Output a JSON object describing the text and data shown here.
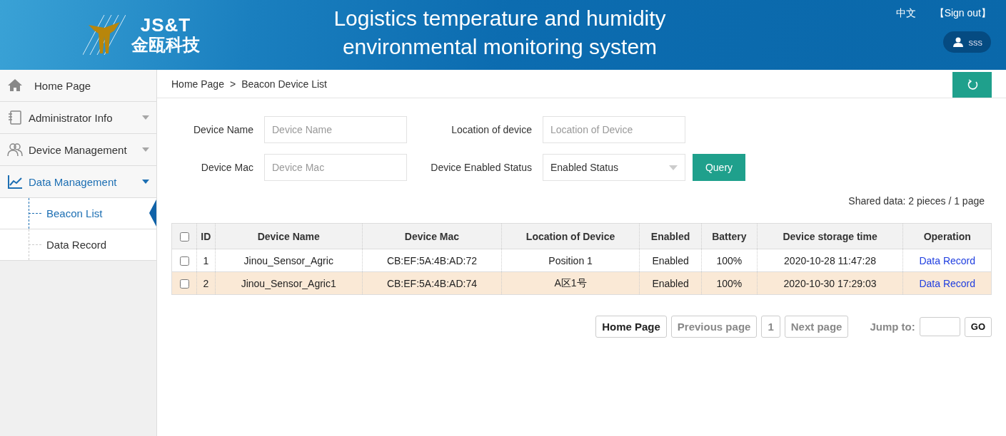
{
  "header": {
    "logo_text": "JS&T",
    "logo_subtext": "金瓯科技",
    "title": "Logistics temperature and humidity environmental monitoring system",
    "language": "中文",
    "sign_out": "【Sign out】",
    "user": "sss"
  },
  "sidebar": {
    "items": [
      {
        "label": "Home Page",
        "selected": false
      },
      {
        "label": "Administrator Info",
        "expanded": false,
        "selected": false
      },
      {
        "label": "Device Management",
        "expanded": false,
        "selected": false
      },
      {
        "label": "Data Management",
        "expanded": true,
        "selected": true,
        "children": [
          {
            "label": "Beacon List",
            "selected": true
          },
          {
            "label": "Data Record",
            "selected": false
          }
        ]
      }
    ]
  },
  "breadcrumb": [
    "Home Page",
    "Beacon Device List"
  ],
  "breadcrumb_separator": ">",
  "filters": [
    {
      "kind": "text",
      "label": "Device Name",
      "placeholder": "Device Name"
    },
    {
      "kind": "text",
      "label": "Location of device",
      "placeholder": "Location of Device"
    },
    {
      "kind": "text",
      "label": "Device Mac",
      "placeholder": "Device Mac"
    },
    {
      "kind": "select",
      "label": "Device Enabled Status",
      "value": "Enabled Status"
    }
  ],
  "query_button": "Query",
  "summary": "Shared data: 2 pieces / 1 page",
  "table": {
    "header_checked": false,
    "columns": [
      "ID",
      "Device Name",
      "Device Mac",
      "Location of Device",
      "Enabled",
      "Battery",
      "Device storage time",
      "Operation"
    ],
    "rows": [
      {
        "checked": false,
        "selected": false,
        "cells": [
          "1",
          "Jinou_Sensor_Agric",
          "CB:EF:5A:4B:AD:72",
          "Position 1",
          "Enabled",
          "100%",
          "2020-10-28 11:47:28"
        ],
        "link": "Data Record"
      },
      {
        "checked": false,
        "selected": true,
        "cells": [
          "2",
          "Jinou_Sensor_Agric1",
          "CB:EF:5A:4B:AD:74",
          "A区1号",
          "Enabled",
          "100%",
          "2020-10-30 17:29:03"
        ],
        "link": "Data Record"
      }
    ]
  },
  "pagination": {
    "buttons": [
      {
        "label": "Home Page",
        "disabled": false
      },
      {
        "label": "Previous page",
        "disabled": true
      },
      {
        "label": "1",
        "disabled": true
      },
      {
        "label": "Next page",
        "disabled": true
      }
    ],
    "jump_label": "Jump to:",
    "go": "GO"
  }
}
